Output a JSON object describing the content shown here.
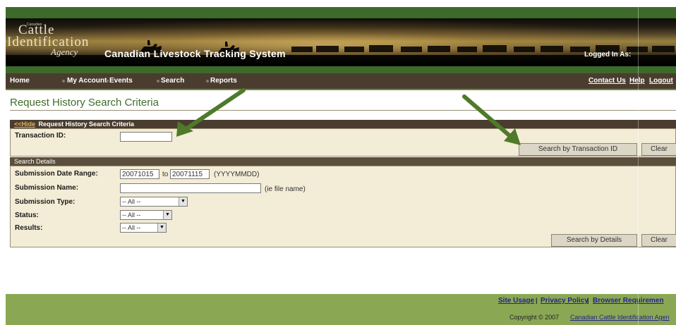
{
  "header": {
    "logo_small": "Canadian",
    "logo_cattle": "Cattle",
    "logo_identification": "Identification",
    "logo_agency": "Agency",
    "system_title": "Canadian Livestock Tracking System",
    "logged_in": "Logged In As:"
  },
  "nav": {
    "items": [
      "Home",
      "My Account",
      "Events",
      "Search",
      "Reports"
    ],
    "right": [
      "Contact Us",
      "Help",
      "Logout"
    ]
  },
  "page_title": "Request History Search Criteria",
  "section1": {
    "toggle": "<<Hide",
    "heading": " Request History Search Criteria",
    "transaction_label": "Transaction ID:",
    "transaction_value": "",
    "search_button": "Search by Transaction ID",
    "clear_button": "Clear"
  },
  "section2": {
    "heading": "Search Details",
    "date_range_label": "Submission Date Range:",
    "date_from": "20071015",
    "to_text": "to",
    "date_to": "20071115",
    "date_format": "(YYYYMMDD)",
    "name_label": "Submission Name:",
    "name_value": "",
    "name_hint": "(ie file name)",
    "type_label": "Submission Type:",
    "type_value": "-- All --",
    "status_label": "Status:",
    "status_value": "-- All --",
    "results_label": "Results:",
    "results_value": "-- All --",
    "search_button": "Search by Details",
    "clear_button": "Clear"
  },
  "footer": {
    "links": [
      "Site Usage",
      "Privacy Policy",
      "Browser Requiremen"
    ],
    "separator": "|",
    "copyright": "Copyright © 2007 ",
    "copyright_link": "Canadian Cattle Identification Agen"
  },
  "colors": {
    "green_band": "#3d6a2a",
    "nav_brown": "#4a3d2f",
    "panel_bg": "#f3ecd6",
    "title_green": "#3f6e2a",
    "footer_green": "#8aa854",
    "arrow_green": "#4f7a2a"
  }
}
